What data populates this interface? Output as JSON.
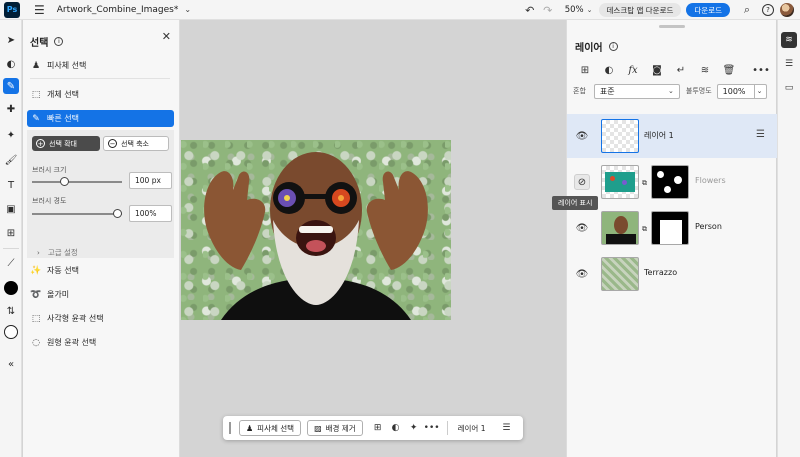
{
  "app": {
    "logo": "Ps",
    "document_title": "Artwork_Combine_Images*"
  },
  "topbar": {
    "zoom": "50%",
    "desktop_button": "데스크탑 앱 다운로드",
    "download_button": "다운로드",
    "icons": [
      "menu-icon",
      "undo-icon",
      "redo-icon",
      "search-icon",
      "help-icon",
      "avatar"
    ]
  },
  "select_panel": {
    "title": "선택",
    "items": {
      "subject": "피사체 선택",
      "object": "개체 선택",
      "quick": "빠른 선택",
      "auto": "자동 선택",
      "lasso": "올가미",
      "rect": "사각형 윤곽 선택",
      "ellipse": "원형 윤곽 선택"
    },
    "quick_options": {
      "add": "선택 확대",
      "subtract": "선택 축소",
      "brush_size_label": "브러시 크기",
      "brush_size_value": "100 px",
      "brush_size_fraction": 0.35,
      "hardness_label": "브러시 경도",
      "hardness_value": "100%",
      "hardness_fraction": 1.0,
      "advanced": "고급 설정"
    }
  },
  "floatbar": {
    "subject_select": "피사체 선택",
    "remove_bg": "배경 제거",
    "layer_label": "레이어 1"
  },
  "layers_panel": {
    "title": "레이어",
    "blend_label": "혼합",
    "blend_value": "표준",
    "opacity_label": "불투명도",
    "opacity_value": "100%",
    "tooltip": "레이어 표시",
    "layers": [
      {
        "name": "레이어 1",
        "selected": true,
        "visible": true
      },
      {
        "name": "Flowers",
        "selected": false,
        "visible": false
      },
      {
        "name": "Person",
        "selected": false,
        "visible": true
      },
      {
        "name": "Terrazzo",
        "selected": false,
        "visible": true
      }
    ]
  },
  "colors": {
    "accent": "#1473e6",
    "foreground": "#000000",
    "background": "#ffffff"
  }
}
